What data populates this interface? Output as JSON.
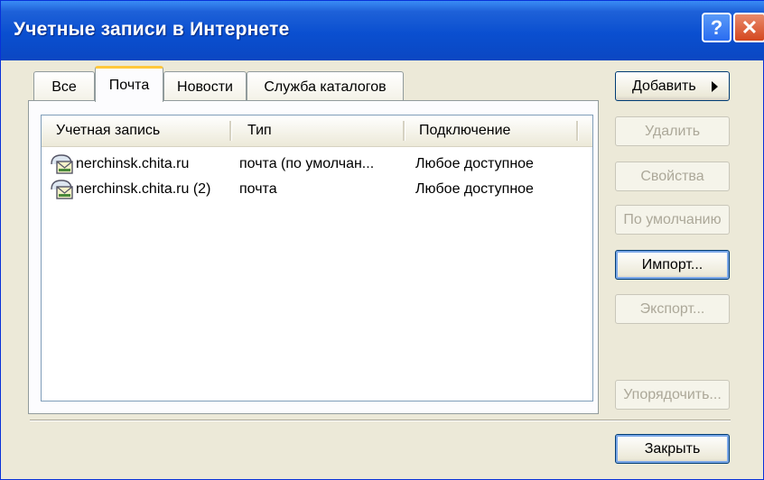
{
  "window": {
    "title": "Учетные записи в Интернете",
    "help_label": "?",
    "close_label": "✕"
  },
  "tabs": [
    {
      "label": "Все",
      "active": false
    },
    {
      "label": "Почта",
      "active": true
    },
    {
      "label": "Новости",
      "active": false
    },
    {
      "label": "Служба каталогов",
      "active": false
    }
  ],
  "table": {
    "columns": [
      "Учетная запись",
      "Тип",
      "Подключение"
    ],
    "rows": [
      {
        "account": "nerchinsk.chita.ru",
        "type": "почта (по умолчан...",
        "connection": "Любое доступное",
        "icon": "mail-account-icon"
      },
      {
        "account": "nerchinsk.chita.ru (2)",
        "type": "почта",
        "connection": "Любое доступное",
        "icon": "mail-account-icon"
      }
    ]
  },
  "buttons": {
    "add": "Добавить",
    "remove": "Удалить",
    "properties": "Свойства",
    "set_default": "По умолчанию",
    "import": "Импорт...",
    "export": "Экспорт...",
    "order": "Упорядочить...",
    "close": "Закрыть"
  },
  "colors": {
    "titlebar": "#0a4fd0",
    "active_tab_accent": "#ffc83c",
    "dialog_bg": "#ece9d8"
  }
}
